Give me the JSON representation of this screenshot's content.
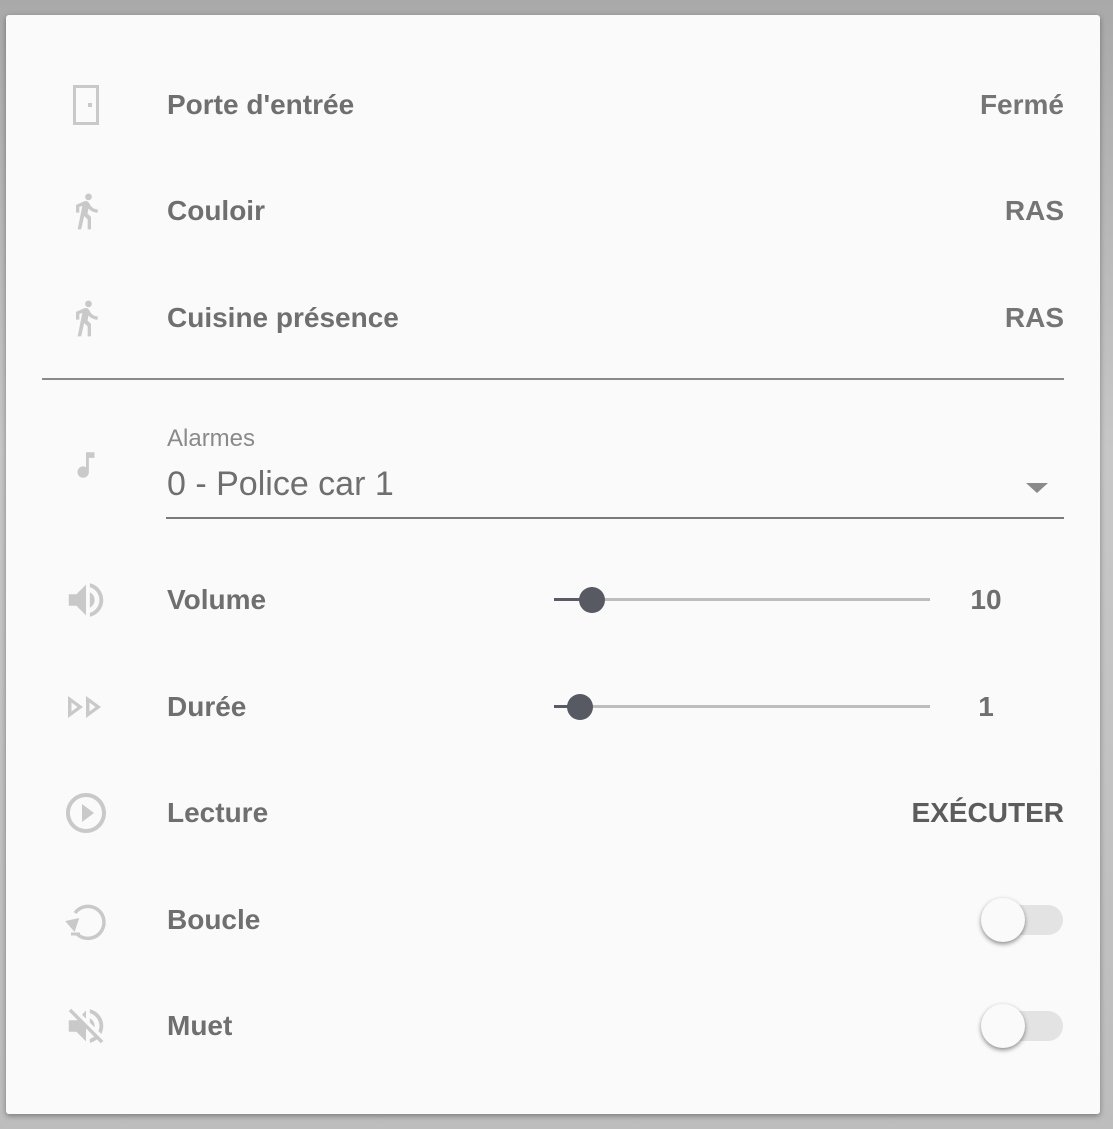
{
  "entities": [
    {
      "icon": "door-icon",
      "label": "Porte d'entrée",
      "state": "Fermé"
    },
    {
      "icon": "walk-icon",
      "label": "Couloir",
      "state": "RAS"
    },
    {
      "icon": "walk-icon",
      "label": "Cuisine présence",
      "state": "RAS"
    }
  ],
  "alarm_select": {
    "icon": "music-note-icon",
    "label": "Alarmes",
    "value": "0 - Police car 1"
  },
  "volume": {
    "icon": "volume-icon",
    "label": "Volume",
    "value": "10",
    "level_fraction": 0.1
  },
  "duree": {
    "icon": "fast-forward-icon",
    "label": "Durée",
    "value": "1",
    "level_fraction": 0.07
  },
  "lecture": {
    "icon": "play-circle-icon",
    "label": "Lecture",
    "action": "EXÉCUTER"
  },
  "boucle": {
    "icon": "repeat-icon",
    "label": "Boucle",
    "on": false
  },
  "muet": {
    "icon": "volume-off-icon",
    "label": "Muet",
    "on": false
  },
  "colors": {
    "accent": "#585a63",
    "text": "#6f6f6f",
    "icon": "#c9c9c9",
    "card": "#fafafa"
  }
}
